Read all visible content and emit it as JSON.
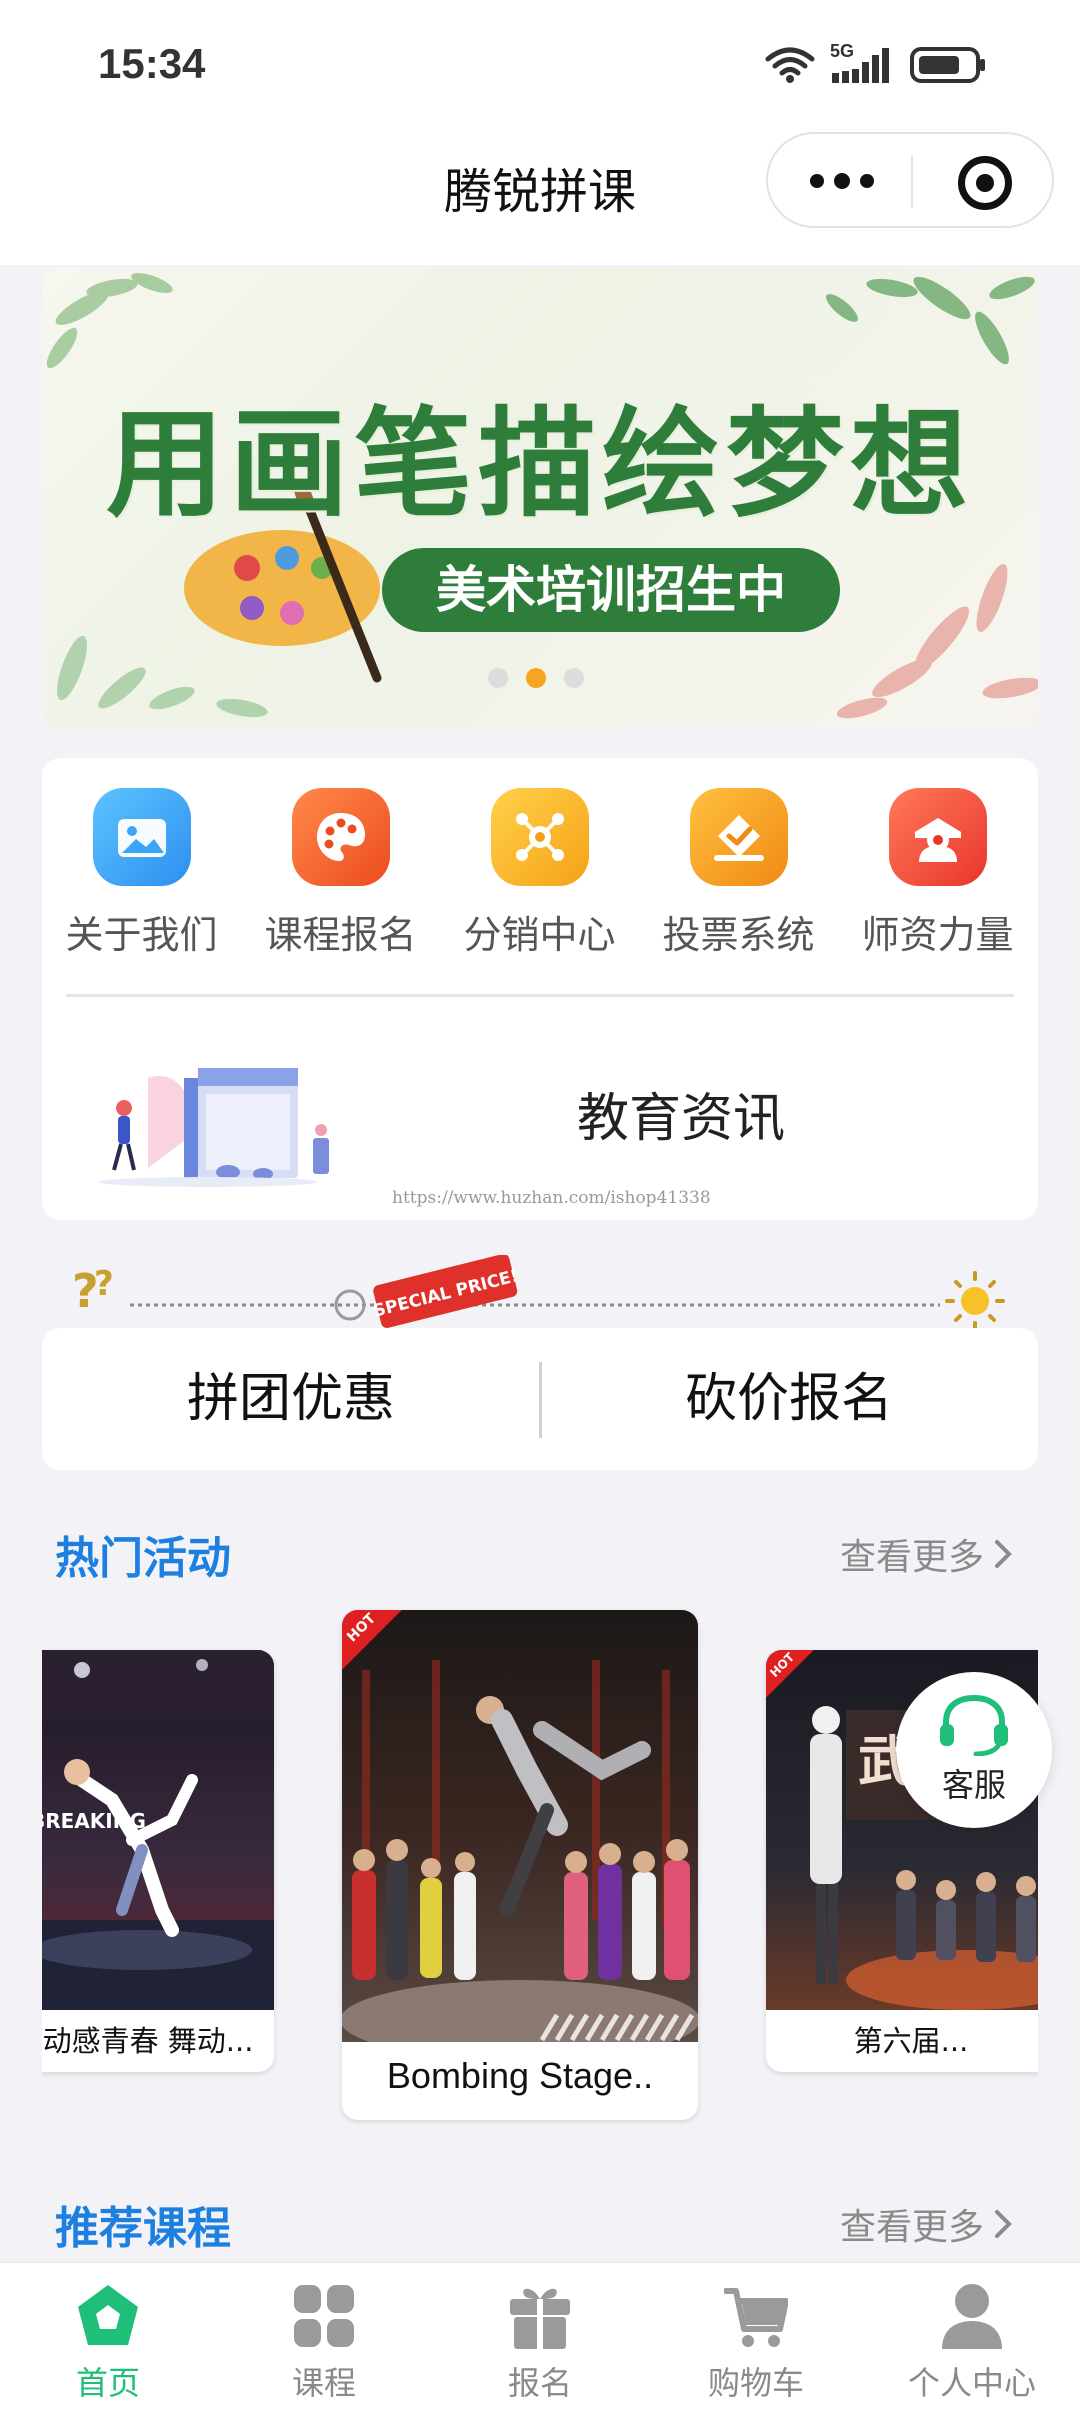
{
  "status_bar": {
    "time": "15:34",
    "network": "5G"
  },
  "header": {
    "title": "腾锐拼课"
  },
  "banner": {
    "headline": "用画笔描绘梦想",
    "tagline": "美术培训招生中",
    "slide_count": 3,
    "active_slide": 2
  },
  "menu": {
    "items": [
      {
        "label": "关于我们",
        "icon": "gallery-icon",
        "color": "#3aa6f5"
      },
      {
        "label": "课程报名",
        "icon": "palette-icon",
        "color": "#f26a2d"
      },
      {
        "label": "分销中心",
        "icon": "distribution-icon",
        "color": "#f5b21a"
      },
      {
        "label": "投票系统",
        "icon": "vote-icon",
        "color": "#f59a1a"
      },
      {
        "label": "师资力量",
        "icon": "teacher-icon",
        "color": "#f0503a"
      }
    ],
    "news_title": "教育资讯",
    "watermark": "https://www.huzhan.com/ishop41338"
  },
  "promo_deco": {
    "badge": "SPECIAL PRICE!"
  },
  "promo": {
    "group_buy": "拼团优惠",
    "bargain": "砍价报名"
  },
  "hot_activities": {
    "title": "热门活动",
    "more": "查看更多",
    "hot_tag": "HOT",
    "cards": [
      {
        "caption": "动感青春 舞动...",
        "photo_text": "BREAKING"
      },
      {
        "caption": "Bombing Stage..",
        "photo_text": ""
      },
      {
        "caption": "第六届...",
        "photo_text": ""
      }
    ]
  },
  "recommended": {
    "title": "推荐课程",
    "more": "查看更多"
  },
  "customer_service": {
    "label": "客服"
  },
  "tab_bar": {
    "active_color": "#1fbf7a",
    "tabs": [
      {
        "label": "首页",
        "icon": "home-icon",
        "active": true
      },
      {
        "label": "课程",
        "icon": "grid-icon",
        "active": false
      },
      {
        "label": "报名",
        "icon": "gift-icon",
        "active": false
      },
      {
        "label": "购物车",
        "icon": "cart-icon",
        "active": false
      },
      {
        "label": "个人中心",
        "icon": "user-icon",
        "active": false
      }
    ]
  }
}
